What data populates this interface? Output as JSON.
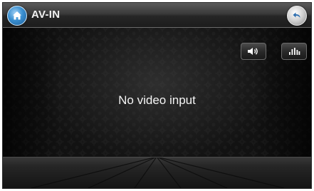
{
  "header": {
    "title": "AV-IN",
    "home_icon": "home-icon",
    "back_icon": "back-arrow-icon"
  },
  "controls": {
    "volume_icon": "speaker-volume-icon",
    "equalizer_icon": "equalizer-bars-icon"
  },
  "video": {
    "message": "No video input"
  },
  "colors": {
    "home_button": "#3a8fd0",
    "title_text": "#f2f2f2",
    "background": "#0d0d0d"
  }
}
